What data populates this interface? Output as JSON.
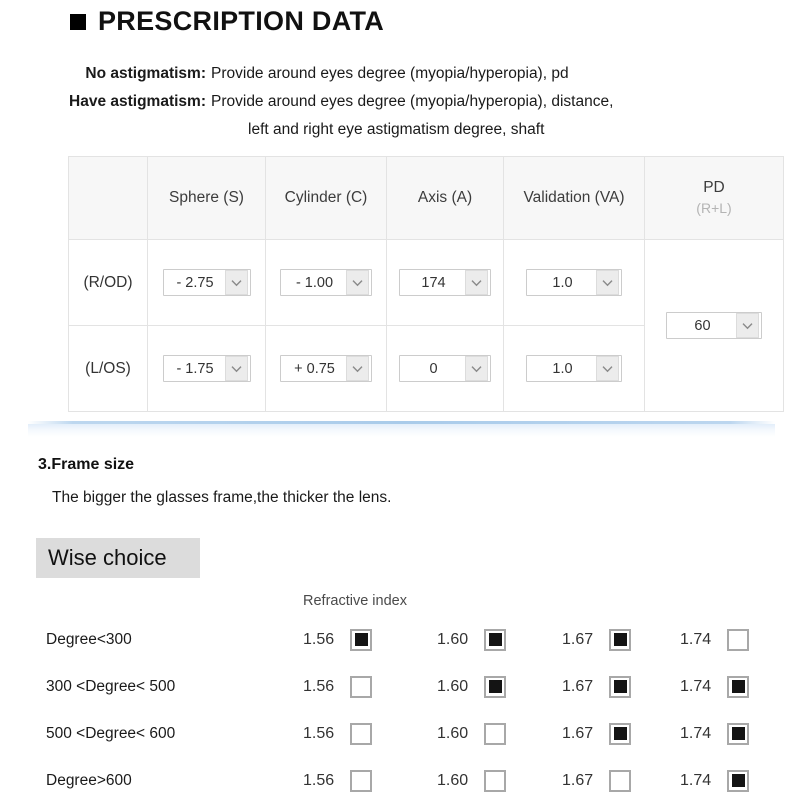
{
  "title": {
    "bullet": "black-square-bullet",
    "text": "PRESCRIPTION DATA"
  },
  "intro": {
    "line1_label": "No astigmatism:",
    "line1_value": "Provide around eyes degree (myopia/hyperopia), pd",
    "line2_label": "Have astigmatism:",
    "line2_value": "Provide around eyes degree (myopia/hyperopia), distance,",
    "line2_cont": "left and right eye astigmatism degree, shaft"
  },
  "rx_table": {
    "headers": {
      "corner": "",
      "sphere": "Sphere (S)",
      "cylinder": "Cylinder (C)",
      "axis": "Axis (A)",
      "validation": "Validation (VA)",
      "pd_main": "PD",
      "pd_sub": "(R+L)"
    },
    "rows": [
      {
        "eye": "(R/OD)",
        "sphere": "- 2.75",
        "cylinder": "- 1.00",
        "axis": "174",
        "validation": "1.0"
      },
      {
        "eye": "(L/OS)",
        "sphere": "- 1.75",
        "cylinder": "+ 0.75",
        "axis": "0",
        "validation": "1.0"
      }
    ],
    "pd_value": "60"
  },
  "frame_section": {
    "heading": "3.Frame size",
    "subtext": "The bigger the glasses frame,the thicker the lens.",
    "wise_choice": "Wise choice"
  },
  "refractive": {
    "caption": "Refractive index",
    "indices": [
      "1.56",
      "1.60",
      "1.67",
      "1.74"
    ],
    "rows": [
      {
        "label": "Degree<300",
        "values": [
          "1.56",
          "1.60",
          "1.67",
          "1.74"
        ],
        "checked": [
          true,
          true,
          true,
          false
        ]
      },
      {
        "label": "300 <Degree< 500",
        "values": [
          "1.56",
          "1.60",
          "1.67",
          "1.74"
        ],
        "checked": [
          false,
          true,
          true,
          true
        ]
      },
      {
        "label": "500 <Degree< 600",
        "values": [
          "1.56",
          "1.60",
          "1.67",
          "1.74"
        ],
        "checked": [
          false,
          false,
          true,
          true
        ]
      },
      {
        "label": "Degree>600",
        "values": [
          "1.56",
          "1.60",
          "1.67",
          "1.74"
        ],
        "checked": [
          false,
          false,
          false,
          true
        ]
      }
    ]
  },
  "colors": {
    "divider_blue": "#a9cbea",
    "table_border": "#e3e3e3",
    "header_bg": "#f7f7f7",
    "wise_choice_bg": "#dcdcdc"
  }
}
